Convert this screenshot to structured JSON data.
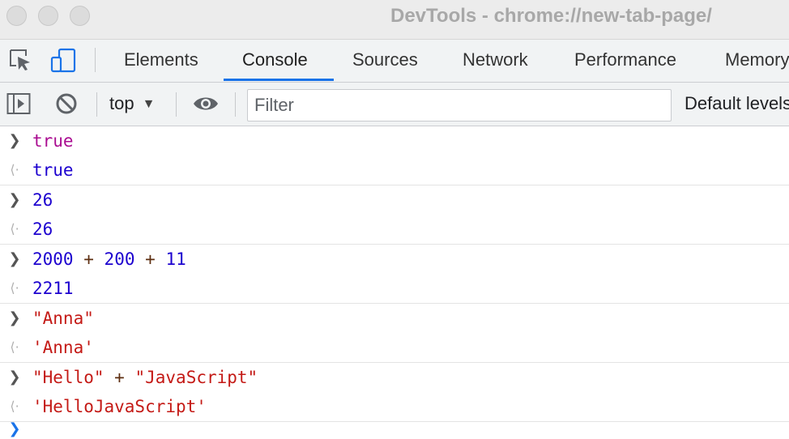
{
  "window": {
    "title": "DevTools - chrome://new-tab-page/"
  },
  "tabs": [
    {
      "label": "Elements",
      "active": false
    },
    {
      "label": "Console",
      "active": true
    },
    {
      "label": "Sources",
      "active": false
    },
    {
      "label": "Network",
      "active": false
    },
    {
      "label": "Performance",
      "active": false
    },
    {
      "label": "Memory",
      "active": false
    }
  ],
  "toolbar": {
    "context": "top",
    "filter_placeholder": "Filter",
    "levels": "Default levels"
  },
  "colors": {
    "accent": "#1a73e8",
    "keyword": "#aa0d91",
    "number": "#1c00cf",
    "string": "#c41a16"
  },
  "console": {
    "entries": [
      {
        "input": [
          "true"
        ],
        "output": "true"
      },
      {
        "input": [
          "26"
        ],
        "output": "26"
      },
      {
        "input": [
          "2000",
          "+",
          "200",
          "+",
          "11"
        ],
        "output": "2211"
      },
      {
        "input": [
          "\"Anna\""
        ],
        "output": "'Anna'"
      },
      {
        "input": [
          "\"Hello\"",
          "+",
          "\"JavaScript\""
        ],
        "output": "'HelloJavaScript'"
      }
    ]
  }
}
